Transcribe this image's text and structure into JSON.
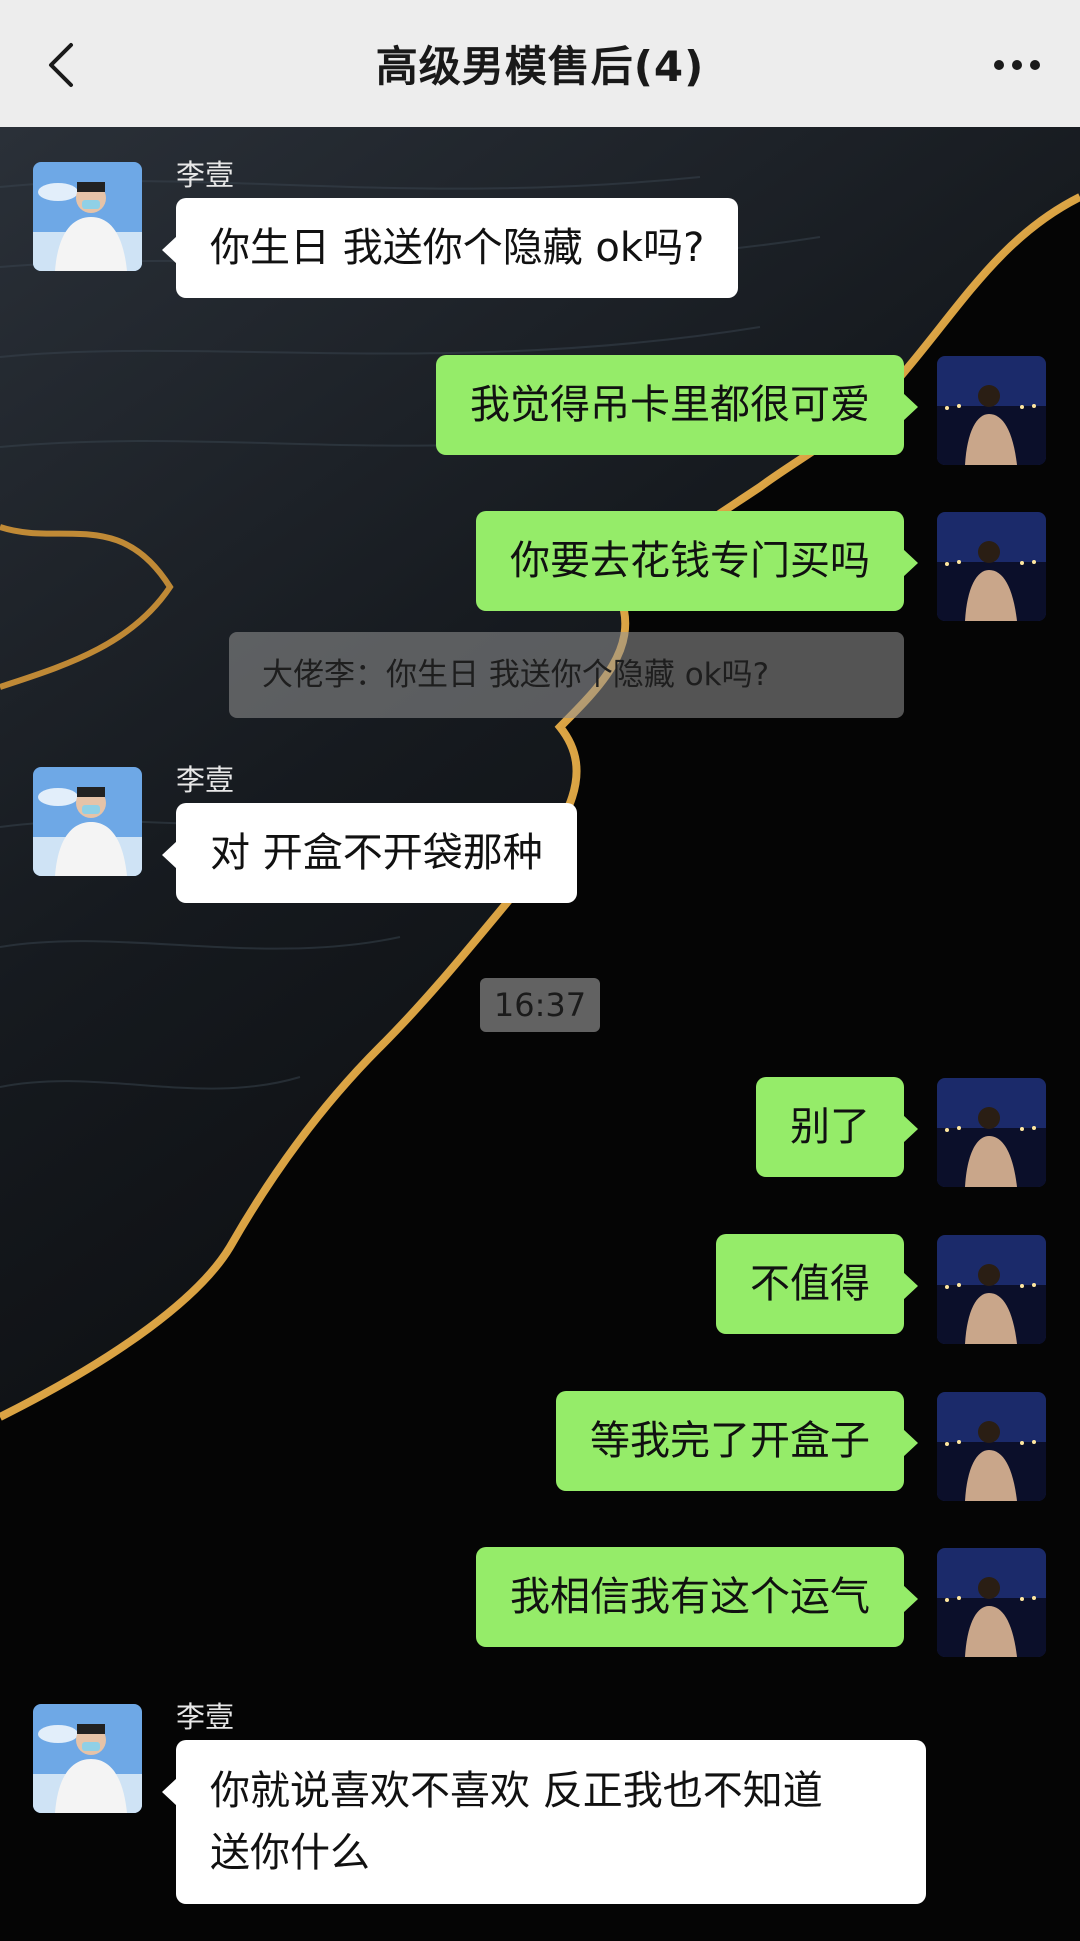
{
  "header": {
    "back_icon": "chevron-left-icon",
    "title": "高级男模售后(4)",
    "more_icon": "ellipsis-icon"
  },
  "colors": {
    "header_bg": "#ededed",
    "outgoing_bubble": "#95ec69",
    "incoming_bubble": "#ffffff"
  },
  "messages": [
    {
      "type": "in",
      "sender": "李壹",
      "text": "你生日 我送你个隐藏 ok吗?"
    },
    {
      "type": "out",
      "text": "我觉得吊卡里都很可爱"
    },
    {
      "type": "out",
      "text": "你要去花钱专门买吗"
    },
    {
      "type": "quote",
      "text": "大佬李：你生日 我送你个隐藏 ok吗?"
    },
    {
      "type": "in",
      "sender": "李壹",
      "text": "对 开盒不开袋那种"
    },
    {
      "type": "time",
      "text": "16:37"
    },
    {
      "type": "out",
      "text": "别了"
    },
    {
      "type": "out",
      "text": "不值得"
    },
    {
      "type": "out",
      "text": "等我完了开盒子"
    },
    {
      "type": "out",
      "text": "我相信我有这个运气"
    },
    {
      "type": "in",
      "sender": "李壹",
      "text_line1": "你就说喜欢不喜欢 反正我也不知道",
      "text_line2": "送你什么"
    }
  ]
}
